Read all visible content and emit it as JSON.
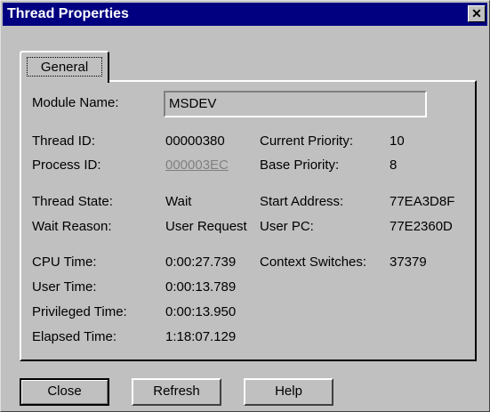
{
  "window": {
    "title": "Thread Properties",
    "close_glyph": "✕"
  },
  "tabs": [
    {
      "label": "General"
    }
  ],
  "module": {
    "label": "Module Name:",
    "value": "MSDEV"
  },
  "ids": {
    "thread_id_label": "Thread ID:",
    "thread_id": "00000380",
    "process_id_label": "Process ID:",
    "process_id": "000003EC",
    "current_priority_label": "Current Priority:",
    "current_priority": "10",
    "base_priority_label": "Base Priority:",
    "base_priority": "8"
  },
  "state": {
    "thread_state_label": "Thread State:",
    "thread_state": "Wait",
    "wait_reason_label": "Wait Reason:",
    "wait_reason": "User Request",
    "start_address_label": "Start Address:",
    "start_address": "77EA3D8F",
    "user_pc_label": "User PC:",
    "user_pc": "77E2360D"
  },
  "times": {
    "cpu_time_label": "CPU Time:",
    "cpu_time": "0:00:27.739",
    "user_time_label": "User Time:",
    "user_time": "0:00:13.789",
    "privileged_time_label": "Privileged Time:",
    "privileged_time": "0:00:13.950",
    "elapsed_time_label": "Elapsed Time:",
    "elapsed_time": "1:18:07.129",
    "context_switches_label": "Context Switches:",
    "context_switches": "37379"
  },
  "buttons": {
    "close": "Close",
    "refresh": "Refresh",
    "help": "Help"
  }
}
